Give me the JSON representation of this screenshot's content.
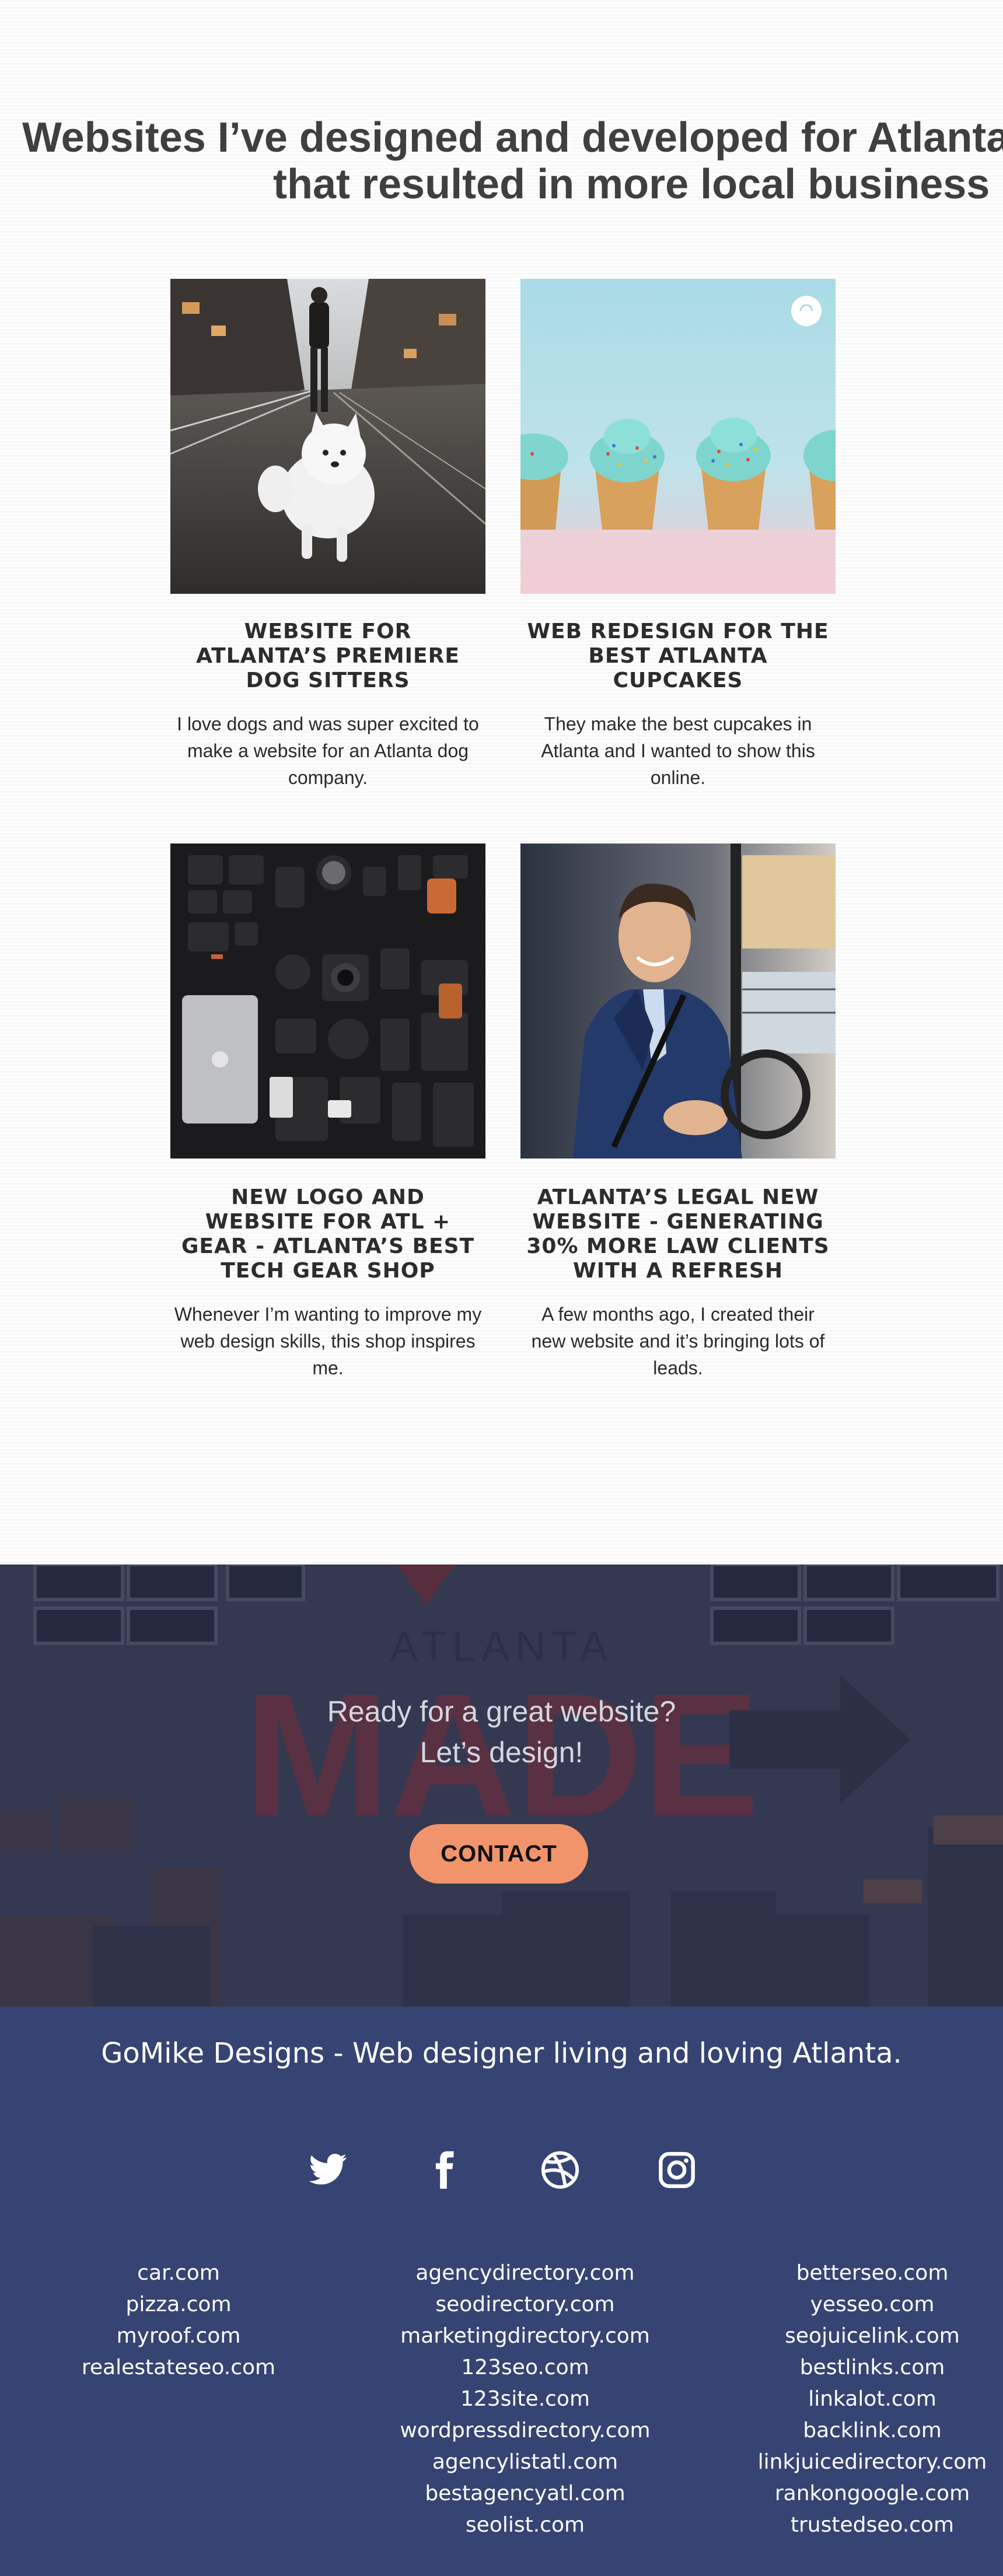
{
  "portfolio": {
    "headline_line1": "Websites I’ve designed and developed for Atlanta companies",
    "headline_line2": "that resulted in more local business",
    "cards": [
      {
        "image_alt": "dog-photo",
        "title": "WEBSITE FOR ATLANTA’S PREMIERE DOG SITTERS",
        "text": "I love dogs and was super excited to make a website for an Atlanta dog company."
      },
      {
        "image_alt": "cupcakes-photo",
        "title": "WEB REDESIGN FOR THE BEST ATLANTA  CUPCAKES",
        "text": "They make the best cupcakes in Atlanta and I wanted to show this online."
      },
      {
        "image_alt": "tech-gear-photo",
        "title": "NEW LOGO AND WEBSITE FOR ATL + GEAR - ATLANTA’S BEST TECH GEAR SHOP",
        "text": "Whenever I’m wanting to improve my web design skills, this shop inspires me."
      },
      {
        "image_alt": "lawyer-photo",
        "title": "ATLANTA’S LEGAL NEW WEBSITE - GENERATING 30% MORE LAW CLIENTS WITH A REFRESH",
        "text": "A few months ago, I created their new website and it’s bringing lots of leads."
      }
    ]
  },
  "cta": {
    "bg_sign_top": "ATLANTA",
    "bg_sign_main": "MADE",
    "line1": "Ready for a great website?",
    "line2": "Let’s design!",
    "button_label": "CONTACT",
    "button_color": "#f2946b"
  },
  "footer": {
    "tagline": "GoMike Designs - Web designer living and loving Atlanta.",
    "background_color": "#364474",
    "social_icons": [
      "twitter-icon",
      "facebook-icon",
      "dribbble-icon",
      "instagram-icon"
    ],
    "links_col1": [
      "car.com",
      "pizza.com",
      "myroof.com",
      "realestateseo.com"
    ],
    "links_col2": [
      "agencydirectory.com",
      "seodirectory.com",
      "marketingdirectory.com",
      "123seo.com",
      "123site.com",
      "wordpressdirectory.com",
      "agencylistatl.com",
      "bestagencyatl.com",
      "seolist.com"
    ],
    "links_col3": [
      "betterseo.com",
      "yesseo.com",
      "seojuicelink.com",
      "bestlinks.com",
      "linkalot.com",
      "backlink.com",
      "linkjuicedirectory.com",
      "rankongoogle.com",
      "trustedseo.com"
    ]
  }
}
